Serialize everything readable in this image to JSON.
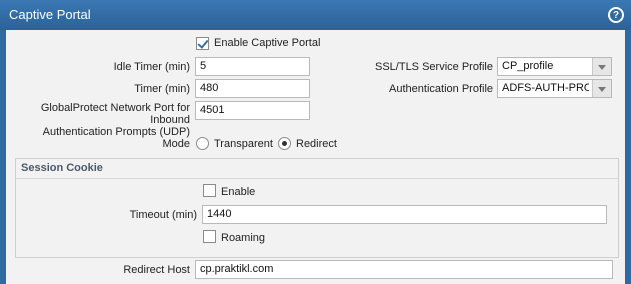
{
  "title": "Captive Portal",
  "help_icon": "question-mark-icon",
  "enable_captive_portal": {
    "label": "Enable Captive Portal",
    "checked": true
  },
  "idle_timer": {
    "label": "Idle Timer (min)",
    "value": "5"
  },
  "timer": {
    "label": "Timer (min)",
    "value": "480"
  },
  "gp_port": {
    "label_line1": "GlobalProtect Network Port for Inbound",
    "label_line2": "Authentication Prompts (UDP)",
    "value": "4501"
  },
  "ssl_profile": {
    "label": "SSL/TLS Service Profile",
    "value": "CP_profile"
  },
  "auth_profile": {
    "label": "Authentication Profile",
    "value": "ADFS-AUTH-PROFILE"
  },
  "mode": {
    "label": "Mode",
    "options": [
      "Transparent",
      "Redirect"
    ],
    "selected": "Redirect"
  },
  "session_cookie": {
    "legend": "Session Cookie",
    "enable": {
      "label": "Enable",
      "checked": false
    },
    "timeout": {
      "label": "Timeout (min)",
      "value": "1440"
    },
    "roaming": {
      "label": "Roaming",
      "checked": false
    }
  },
  "redirect_host": {
    "label": "Redirect Host",
    "value": "cp.praktikl.com"
  }
}
